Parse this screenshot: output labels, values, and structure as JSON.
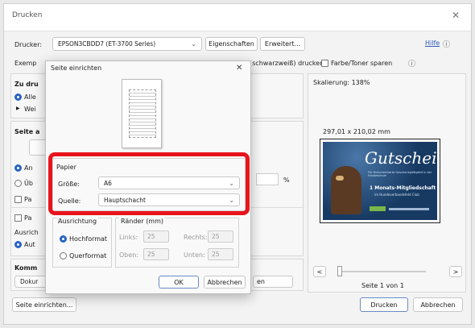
{
  "window": {
    "title": "Drucken",
    "close_glyph": "✕"
  },
  "printer": {
    "label": "Drucker:",
    "value": "EPSON3CBDD7 (ET-3700 Series)",
    "properties_button": "Eigenschaften",
    "advanced_button": "Erweitert...",
    "help_link": "Hilfe",
    "help_icon": "ⓘ"
  },
  "copies": {
    "label_partial": "Exemp",
    "grayscale_partial": "(schwarzweiß) drucken",
    "save_ink_label": "Farbe/Toner sparen",
    "info_icon": "ⓘ"
  },
  "range": {
    "heading_partial": "Zu dru",
    "all_partial": "Alle",
    "more_partial": "Wei"
  },
  "page_section": {
    "heading_partial": "Seite a",
    "opt1_partial": "An",
    "opt2_partial": "Üb",
    "opt3_partial": "Pa",
    "opt4_partial": "Pa",
    "orient_partial": "Ausrich",
    "auto_partial": "Aut",
    "percent_sign": "%"
  },
  "comments": {
    "heading_partial": "Komm",
    "select_partial": "Dokur",
    "button_partial": "en"
  },
  "preview": {
    "scaling": "Skalierung: 138%",
    "dimensions": "297,01 x 210,02 mm",
    "voucher_title": "Gutschein",
    "voucher_subtitle": "Für Gutscheinkarte Geschenkgültigkeit in der Hundeschule",
    "voucher_offer": "1 Monats-Mitgliedschaft",
    "voucher_offer_sub": "im Hundeverbandsfeld Club",
    "page_info": "Seite 1 von 1",
    "prev_glyph": "<",
    "next_glyph": ">"
  },
  "footer": {
    "setup_button": "Seite einrichten...",
    "print_button": "Drucken",
    "cancel_button": "Abbrechen"
  },
  "setup_dialog": {
    "title": "Seite einrichten",
    "close_glyph": "✕",
    "paper": {
      "legend": "Papier",
      "size_label": "Größe:",
      "size_value": "A6",
      "source_label": "Quelle:",
      "source_value": "Hauptschacht"
    },
    "orientation": {
      "legend": "Ausrichtung",
      "portrait": "Hochformat",
      "landscape": "Querformat"
    },
    "margins": {
      "legend": "Ränder (mm)",
      "left_label": "Links:",
      "left_value": "25",
      "right_label": "Rechts:",
      "right_value": "25",
      "top_label": "Oben:",
      "top_value": "25",
      "bottom_label": "Unten:",
      "bottom_value": "25"
    },
    "ok_button": "OK",
    "cancel_button": "Abbrechen"
  },
  "colors": {
    "highlight": "#e8141c",
    "accent": "#2963c4",
    "voucher_bg": "#173a63"
  }
}
